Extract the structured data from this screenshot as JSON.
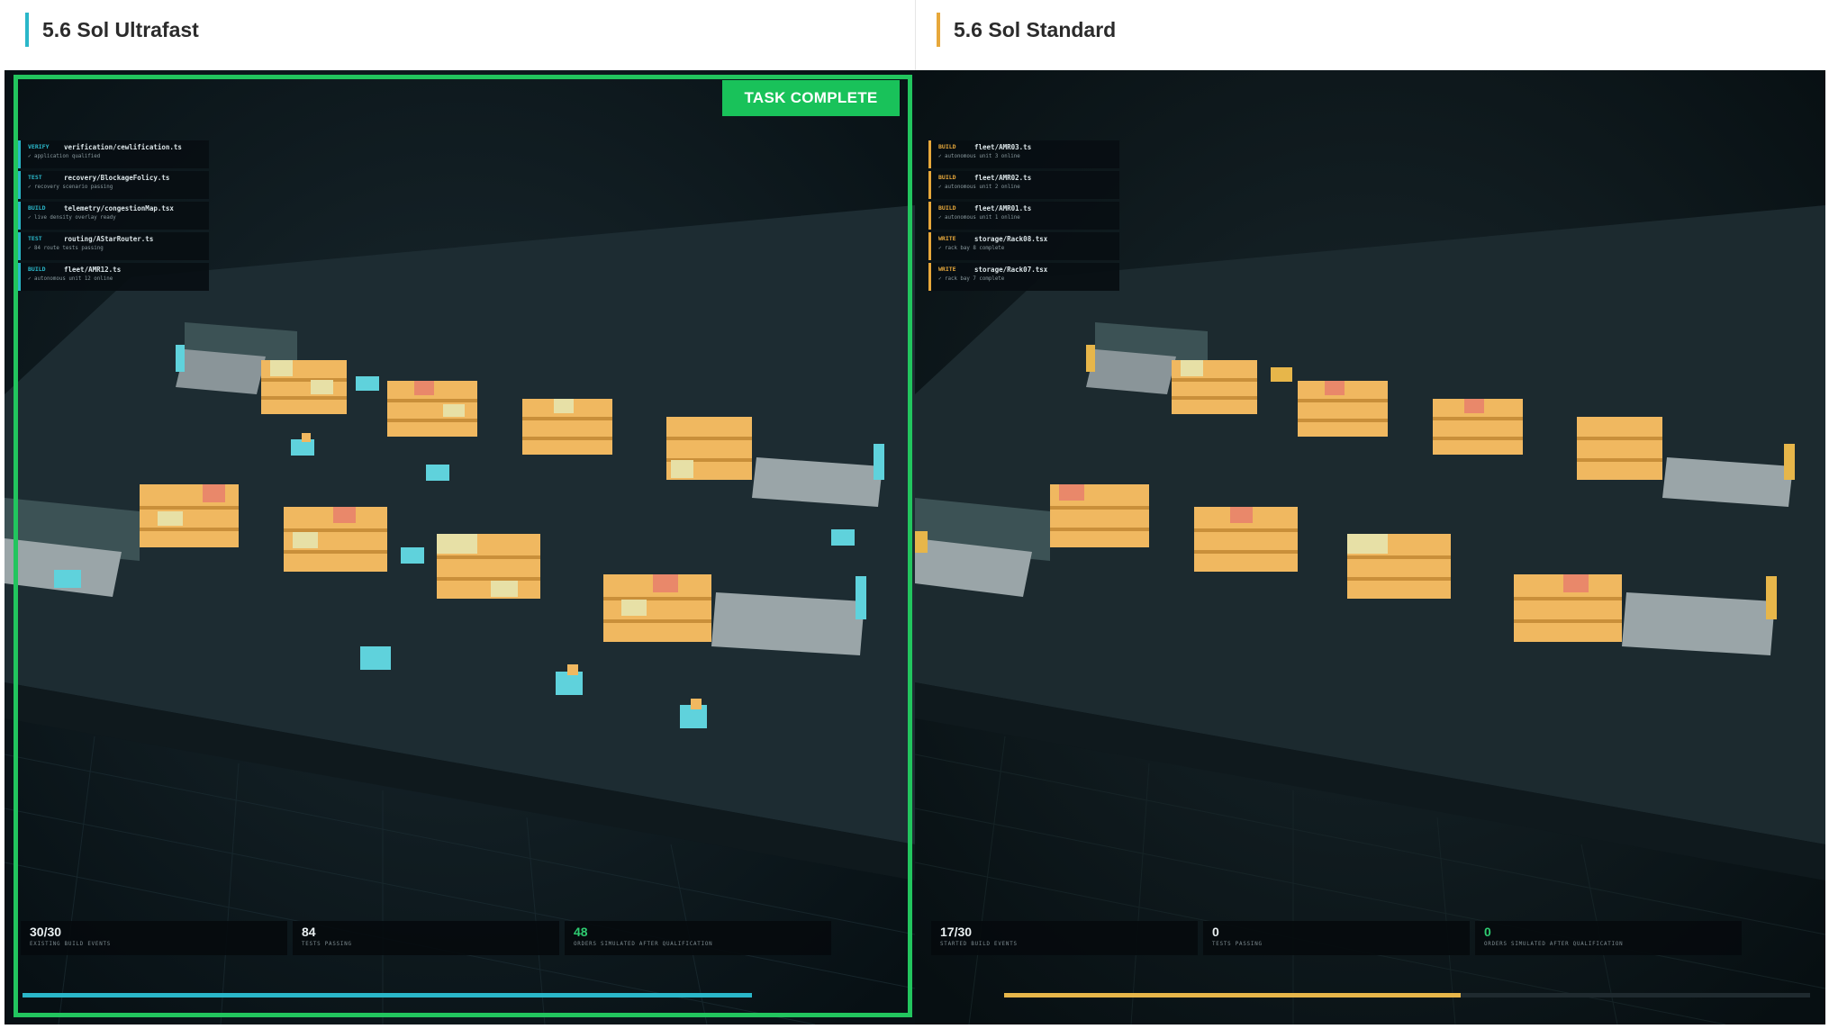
{
  "columns": [
    {
      "title": "5.6 Sol Ultrafast",
      "accent": "#2ab7c9",
      "status_badge": "TASK COMPLETE",
      "log": [
        {
          "kind": "VERIFY",
          "file": "verification/cewlification.ts",
          "note": "✓ application qualified"
        },
        {
          "kind": "TEST",
          "file": "recovery/BlockageFolicy.ts",
          "note": "✓ recovery scenario passing"
        },
        {
          "kind": "BUILD",
          "file": "telemetry/congestionMap.tsx",
          "note": "✓ live density overlay ready"
        },
        {
          "kind": "TEST",
          "file": "routing/AStarRouter.ts",
          "note": "✓ 84 route tests passing"
        },
        {
          "kind": "BUILD",
          "file": "fleet/AMR12.ts",
          "note": "✓ autonomous unit 12 online"
        }
      ],
      "stats": [
        {
          "value": "30/30",
          "label": "EXISTING BUILD EVENTS"
        },
        {
          "value": "84",
          "label": "TESTS PASSING"
        },
        {
          "value": "48",
          "label": "ORDERS SIMULATED AFTER QUALIFICATION"
        }
      ],
      "progress": 0.9
    },
    {
      "title": "5.6 Sol Standard",
      "accent": "#e7a83b",
      "log": [
        {
          "kind": "BUILD",
          "file": "fleet/AMR03.ts",
          "note": "✓ autonomous unit 3 online"
        },
        {
          "kind": "BUILD",
          "file": "fleet/AMR02.ts",
          "note": "✓ autonomous unit 2 online"
        },
        {
          "kind": "BUILD",
          "file": "fleet/AMR01.ts",
          "note": "✓ autonomous unit 1 online"
        },
        {
          "kind": "WRITE",
          "file": "storage/Rack08.tsx",
          "note": "✓ rack bay 8 complete"
        },
        {
          "kind": "WRITE",
          "file": "storage/Rack07.tsx",
          "note": "✓ rack bay 7 complete"
        }
      ],
      "stats": [
        {
          "value": "17/30",
          "label": "STARTED BUILD EVENTS"
        },
        {
          "value": "0",
          "label": "TESTS PASSING"
        },
        {
          "value": "0",
          "label": "ORDERS SIMULATED AFTER QUALIFICATION"
        }
      ],
      "progress": 0.567
    }
  ]
}
